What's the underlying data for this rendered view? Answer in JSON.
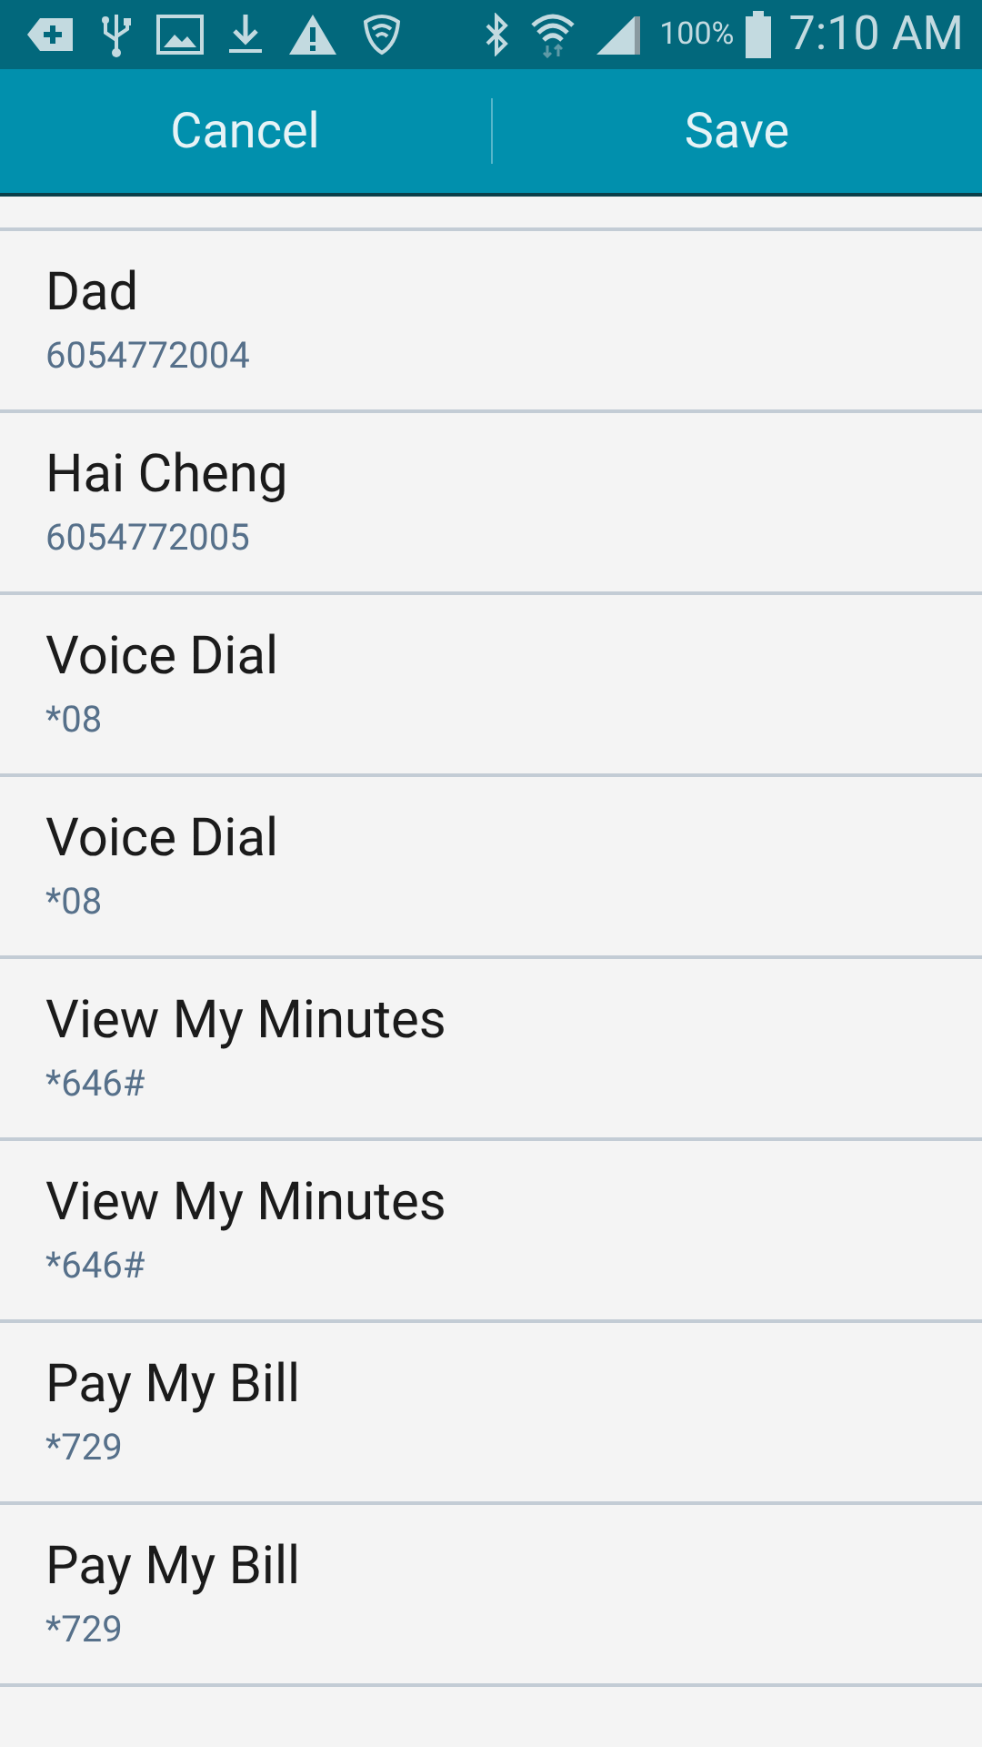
{
  "status_bar": {
    "battery_text": "100%",
    "time": "7:10 AM"
  },
  "action_bar": {
    "buttons": [
      "Cancel",
      "Save"
    ]
  },
  "contacts": [
    {
      "name": "Dad",
      "number": "6054772004"
    },
    {
      "name": "Hai Cheng",
      "number": "6054772005"
    },
    {
      "name": "Voice Dial",
      "number": "*08"
    },
    {
      "name": "Voice Dial",
      "number": "*08"
    },
    {
      "name": "View My Minutes",
      "number": "*646#"
    },
    {
      "name": "View My Minutes",
      "number": "*646#"
    },
    {
      "name": "Pay My Bill",
      "number": "*729"
    },
    {
      "name": "Pay My Bill",
      "number": "*729"
    }
  ]
}
